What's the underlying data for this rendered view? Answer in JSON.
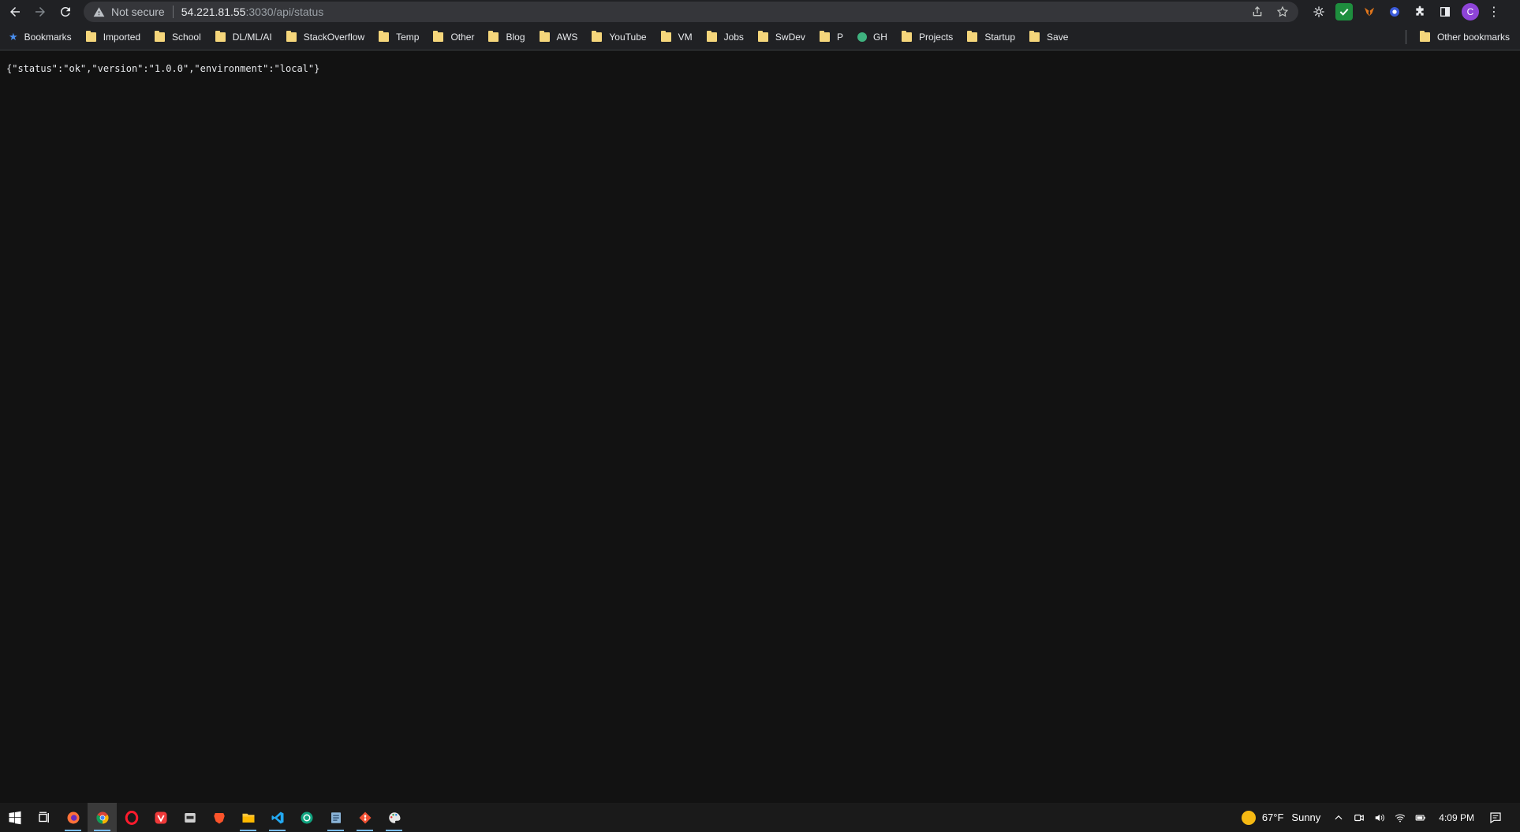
{
  "toolbar": {
    "security_label": "Not secure",
    "url_host": "54.221.81.55",
    "url_rest": ":3030/api/status",
    "profile_initial": "C"
  },
  "bookmarks": {
    "items": [
      {
        "label": "Bookmarks",
        "icon": "star-icon"
      },
      {
        "label": "Imported",
        "icon": "folder-icon"
      },
      {
        "label": "School",
        "icon": "folder-icon"
      },
      {
        "label": "DL/ML/AI",
        "icon": "folder-icon"
      },
      {
        "label": "StackOverflow",
        "icon": "folder-icon"
      },
      {
        "label": "Temp",
        "icon": "folder-icon"
      },
      {
        "label": "Other",
        "icon": "folder-icon"
      },
      {
        "label": "Blog",
        "icon": "folder-icon"
      },
      {
        "label": "AWS",
        "icon": "folder-icon"
      },
      {
        "label": "YouTube",
        "icon": "folder-icon"
      },
      {
        "label": "VM",
        "icon": "folder-icon"
      },
      {
        "label": "Jobs",
        "icon": "folder-icon"
      },
      {
        "label": "SwDev",
        "icon": "folder-icon"
      },
      {
        "label": "P",
        "icon": "folder-icon"
      },
      {
        "label": "GH",
        "icon": "github-icon"
      },
      {
        "label": "Projects",
        "icon": "folder-icon"
      },
      {
        "label": "Startup",
        "icon": "folder-icon"
      },
      {
        "label": "Save",
        "icon": "folder-icon"
      }
    ],
    "other_label": "Other bookmarks"
  },
  "content": {
    "json_text": "{\"status\":\"ok\",\"version\":\"1.0.0\",\"environment\":\"local\"}"
  },
  "taskbar": {
    "weather": "67°F",
    "weather_desc": "Sunny",
    "clock": "4:09 PM"
  }
}
